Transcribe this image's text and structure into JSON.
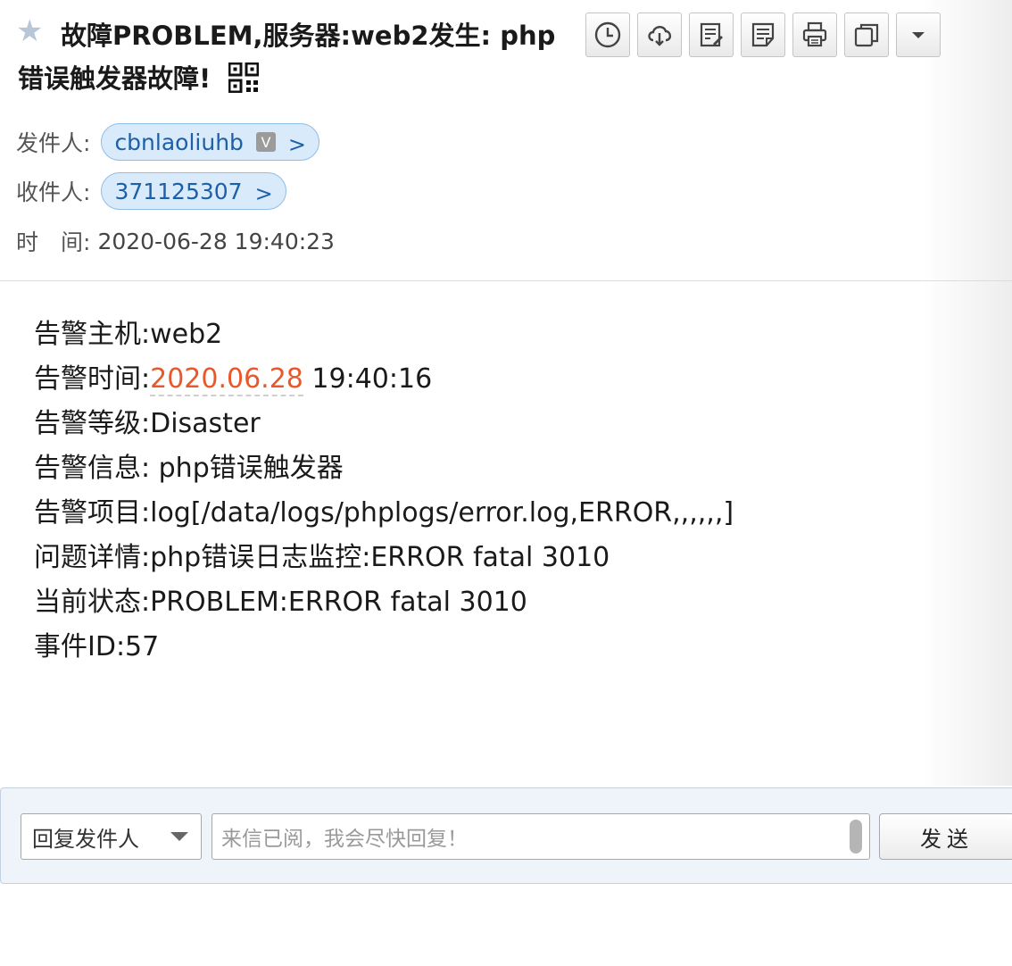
{
  "header": {
    "star_icon": "star-icon",
    "subject_line1": "故障PROBLEM,服务器:web2发生: php",
    "subject_line2": "错误触发器故障!",
    "qr_icon": "qr-code-icon"
  },
  "toolbar": {
    "buttons": [
      {
        "name": "clock-icon"
      },
      {
        "name": "cloud-save-icon"
      },
      {
        "name": "edit-note-icon"
      },
      {
        "name": "note-icon"
      },
      {
        "name": "print-icon"
      },
      {
        "name": "copy-window-icon"
      },
      {
        "name": "more-dropdown-icon"
      }
    ]
  },
  "meta": {
    "from_label": "发件人:",
    "from_name": "cbnlaoliuhb",
    "from_badge": "V",
    "to_label": "收件人:",
    "to_name": "371125307",
    "chip_arrow": ">",
    "time_label": "时　间:",
    "time_value": "2020-06-28 19:40:23"
  },
  "body": {
    "host": "告警主机:web2",
    "time_prefix": "告警时间:",
    "time_date": "2020.06.28",
    "time_rest": " 19:40:16",
    "level": "告警等级:Disaster",
    "info": "告警信息: php错误触发器",
    "item": "告警项目:log[/data/logs/phplogs/error.log,ERROR,,,,,,]",
    "detail": "问题详情:php错误日志监控:ERROR fatal 3010",
    "status": "当前状态:PROBLEM:ERROR fatal 3010",
    "event_id": "事件ID:57"
  },
  "reply": {
    "select_value": "回复发件人",
    "input_placeholder": "来信已阅，我会尽快回复！",
    "send_label": "发送"
  },
  "colors": {
    "accent_link": "#1d5fa8",
    "chip_bg": "#d9ebfa",
    "date_highlight": "#e8582a",
    "reply_bg": "#eef4fa"
  }
}
